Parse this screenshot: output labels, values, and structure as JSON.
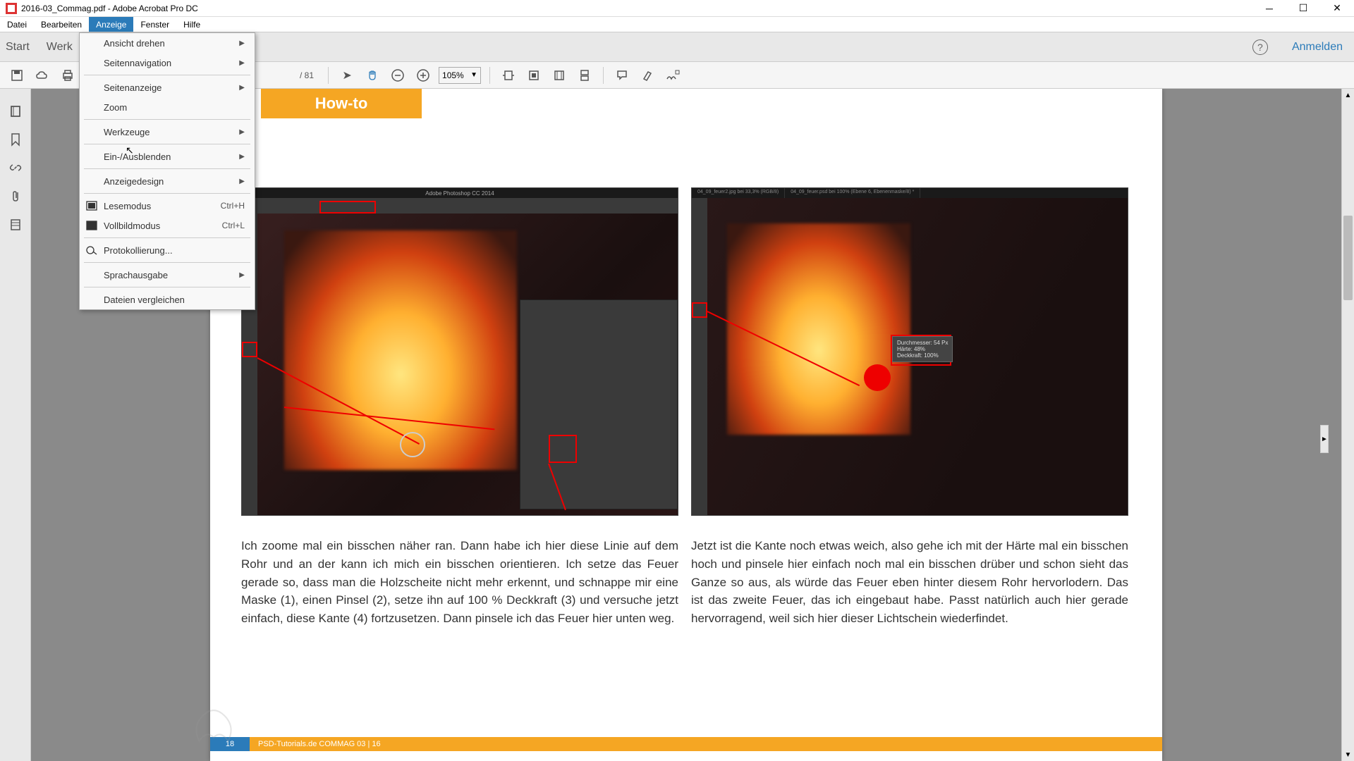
{
  "window": {
    "title": "2016-03_Commag.pdf - Adobe Acrobat Pro DC"
  },
  "menubar": [
    "Datei",
    "Bearbeiten",
    "Anzeige",
    "Fenster",
    "Hilfe"
  ],
  "menubar_active_index": 2,
  "tabs": {
    "start": "Start",
    "tools": "Werk",
    "login": "Anmelden"
  },
  "toolbar": {
    "page_count": "81",
    "zoom": "105%"
  },
  "dropdown": {
    "items": [
      {
        "label": "Ansicht drehen",
        "submenu": true
      },
      {
        "label": "Seitennavigation",
        "submenu": true
      },
      {
        "sep": true
      },
      {
        "label": "Seitenanzeige",
        "submenu": true
      },
      {
        "label": "Zoom"
      },
      {
        "sep": true
      },
      {
        "label": "Werkzeuge",
        "submenu": true
      },
      {
        "sep": true
      },
      {
        "label": "Ein-/Ausblenden",
        "submenu": true
      },
      {
        "sep": true
      },
      {
        "label": "Anzeigedesign",
        "submenu": true
      },
      {
        "sep": true
      },
      {
        "label": "Lesemodus",
        "icon": "read",
        "shortcut": "Ctrl+H"
      },
      {
        "label": "Vollbildmodus",
        "icon": "full",
        "shortcut": "Ctrl+L"
      },
      {
        "sep": true
      },
      {
        "label": "Protokollierung...",
        "icon": "tracker"
      },
      {
        "sep": true
      },
      {
        "label": "Sprachausgabe",
        "submenu": true
      },
      {
        "sep": true
      },
      {
        "label": "Dateien vergleichen"
      }
    ]
  },
  "document": {
    "howto_label": "How-to",
    "photoshop_title": "Adobe Photoshop CC 2014",
    "ps_tab1": "04_09_feuer2.jpg bei 33,3% (RGB/8)",
    "ps_tab2": "04_09_feuer.psd bei 100% (Ebene 6, Ebenenmaske/8) *",
    "tooltip_lines": [
      "Durchmesser: 54 Px",
      "Härte: 48%",
      "Deckkraft: 100%"
    ],
    "col1": "Ich zoome mal ein bisschen näher ran. Dann habe ich hier diese Linie auf dem Rohr und an der kann ich mich ein bisschen orientieren. Ich setze das Feuer gerade so, dass man die Holzscheite nicht mehr erkennt, und schnappe mir eine Maske (1), einen Pinsel (2), setze ihn auf 100 % Deckkraft (3) und versuche jetzt einfach, diese Kante (4) fortzusetzen. Dann pinsele ich das Feuer hier unten weg.",
    "col2": "Jetzt ist die Kante noch etwas weich, also gehe ich mit der Härte mal ein bisschen hoch und pinsele hier einfach noch mal ein bisschen drüber und schon sieht das Ganze so aus, als würde das Feuer eben hinter diesem Rohr hervorlodern. Das ist das zweite Feuer, das ich eingebaut habe. Passt natürlich auch hier gerade hervorragend, weil sich hier dieser Lichtschein wiederfindet.",
    "footer_page": "18",
    "footer_text": "PSD-Tutorials.de   COMMAG 03 | 16"
  }
}
